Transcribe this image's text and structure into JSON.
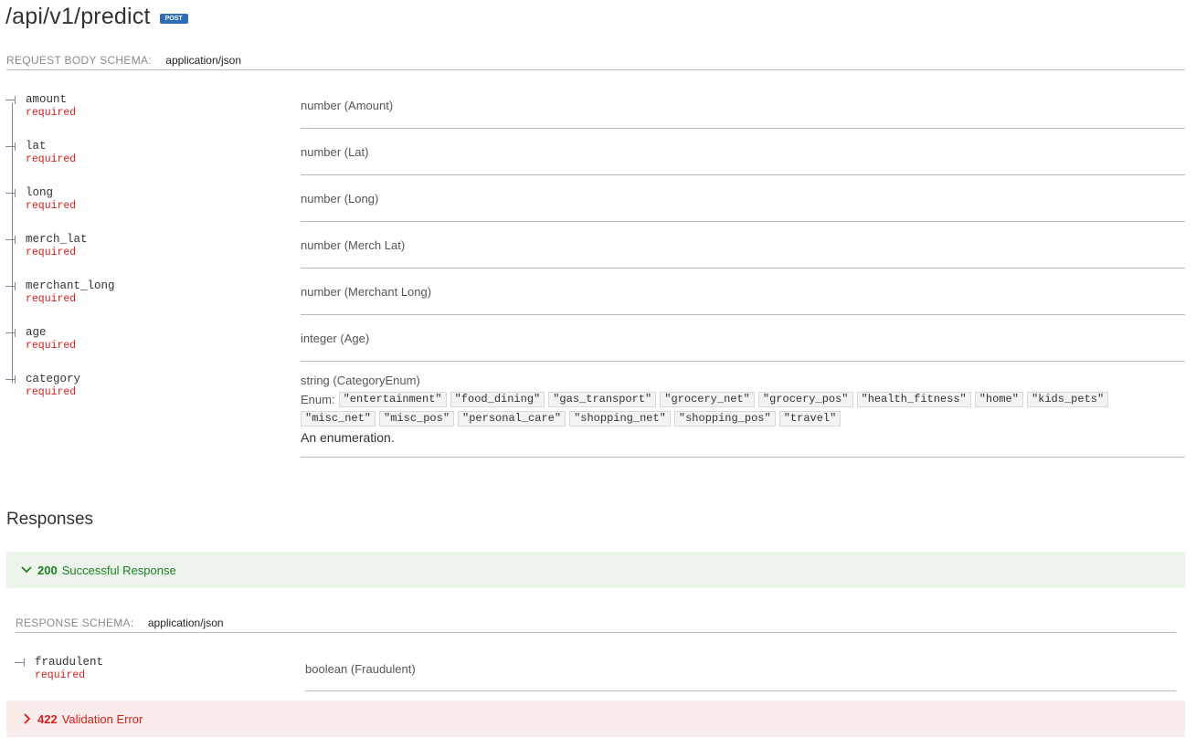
{
  "endpoint": {
    "path": "/api/v1/predict",
    "method": "POST"
  },
  "request_schema": {
    "label": "REQUEST BODY SCHEMA:",
    "content_type": "application/json",
    "fields": [
      {
        "name": "amount",
        "required": "required",
        "type": "number (Amount)"
      },
      {
        "name": "lat",
        "required": "required",
        "type": "number (Lat)"
      },
      {
        "name": "long",
        "required": "required",
        "type": "number (Long)"
      },
      {
        "name": "merch_lat",
        "required": "required",
        "type": "number (Merch Lat)"
      },
      {
        "name": "merchant_long",
        "required": "required",
        "type": "number (Merchant Long)"
      },
      {
        "name": "age",
        "required": "required",
        "type": "integer (Age)"
      },
      {
        "name": "category",
        "required": "required",
        "type": "string (CategoryEnum)"
      }
    ],
    "enum": {
      "label": "Enum:",
      "values_row1": [
        "\"entertainment\"",
        "\"food_dining\"",
        "\"gas_transport\"",
        "\"grocery_net\"",
        "\"grocery_pos\"",
        "\"health_fitness\"",
        "\"home\"",
        "\"kids_pets\""
      ],
      "values_row2": [
        "\"misc_net\"",
        "\"misc_pos\"",
        "\"personal_care\"",
        "\"shopping_net\"",
        "\"shopping_pos\"",
        "\"travel\""
      ],
      "description": "An enumeration."
    }
  },
  "responses": {
    "title": "Responses",
    "success": {
      "code": "200",
      "description": "Successful Response",
      "color": "#1d8121"
    },
    "response_schema": {
      "label": "RESPONSE SCHEMA:",
      "content_type": "application/json",
      "field": {
        "name": "fraudulent",
        "required": "required",
        "type": "boolean (Fraudulent)"
      }
    },
    "error": {
      "code": "422",
      "description": "Validation Error",
      "color": "#d41f1c"
    }
  },
  "icons": {
    "expand": "chevron-down-icon",
    "collapsed": "chevron-right-icon",
    "tree": "tree-branch-icon"
  }
}
